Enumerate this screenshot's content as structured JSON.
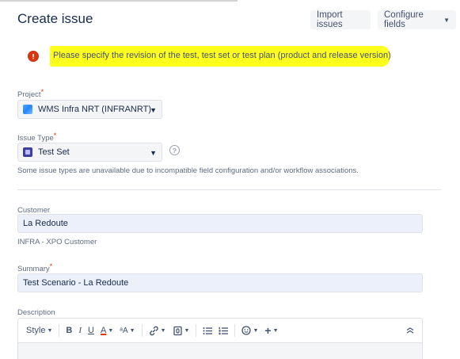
{
  "header": {
    "title": "Create issue",
    "import_label": "Import issues",
    "configure_label": "Configure fields",
    "configure_icon": "chevron-down-icon"
  },
  "error": {
    "icon": "error-icon",
    "message": "Please specify the revision of the test, test set or test plan (product and release version)",
    "highlight_color": "#ffff1e"
  },
  "project": {
    "label": "Project",
    "required_mark": "*",
    "value": "WMS Infra NRT (INFRANRT)"
  },
  "issue_type": {
    "label": "Issue Type",
    "required_mark": "*",
    "value": "Test Set",
    "help_icon": "?",
    "note": "Some issue types are unavailable due to incompatible field configuration and/or workflow associations."
  },
  "customer": {
    "label": "Customer",
    "value": "La Redoute",
    "description": "INFRA - XPO Customer"
  },
  "summary": {
    "label": "Summary",
    "required_mark": "*",
    "value": "Test Scenario - La Redoute"
  },
  "description": {
    "label": "Description",
    "toolbar": {
      "style": "Style",
      "bold": "B",
      "italic": "I",
      "underline": "U",
      "text_color": "A",
      "more_formatting": "ᵃA",
      "link": "🔗",
      "attachment": "📎",
      "bullet_list": "☰",
      "numbered_list": "☰",
      "emoji": "☺",
      "insert": "+",
      "collapse": "≈"
    }
  },
  "colors": {
    "accent": "#0052cc",
    "required": "#de350b",
    "input_bg": "#ebf0fb"
  }
}
